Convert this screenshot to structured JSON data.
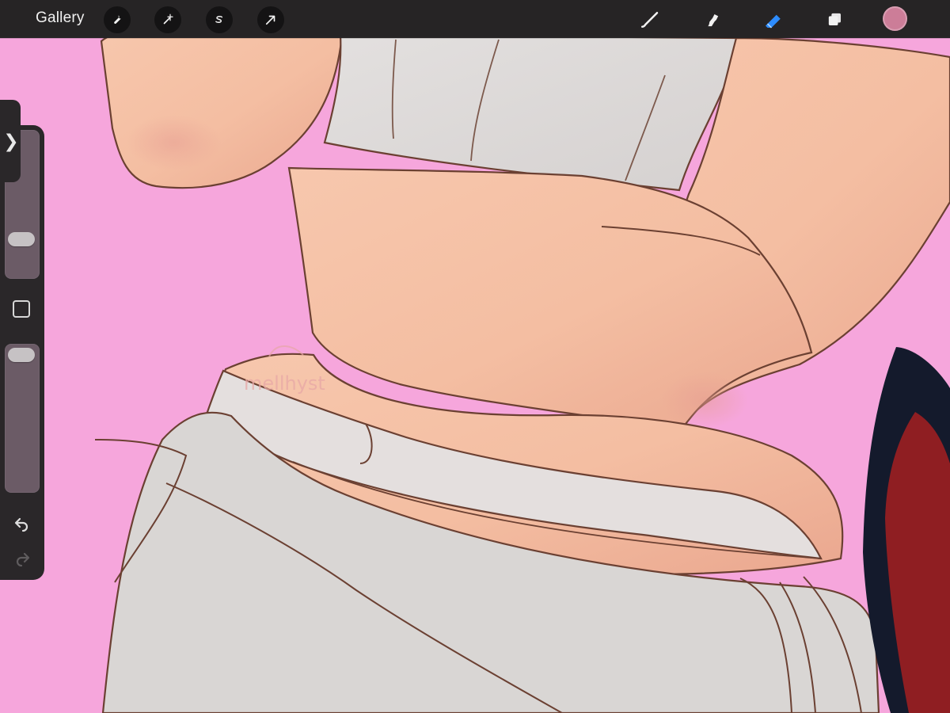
{
  "topbar": {
    "gallery_label": "Gallery",
    "tools_left": [
      {
        "name": "wrench-icon"
      },
      {
        "name": "magic-wand-icon"
      },
      {
        "name": "selection-icon"
      },
      {
        "name": "transform-arrow-icon"
      }
    ],
    "tools_right": [
      {
        "name": "brush-icon"
      },
      {
        "name": "smudge-icon"
      },
      {
        "name": "eraser-icon"
      },
      {
        "name": "layers-icon"
      }
    ],
    "current_color": "#cc7d98"
  },
  "sidebar": {
    "toggle_icon": "chevron-right-icon",
    "size_slider_level": 0.72,
    "opacity_slider_level": 0.08,
    "undo_icon": "undo-icon",
    "redo_icon": "redo-icon"
  },
  "canvas": {
    "signature_text": "mellhyst",
    "background_color": "#f6a6dc",
    "skin_color": "#f4c2a6",
    "clothing_color": "#dad7d6",
    "accent_red": "#8f1e22",
    "accent_navy": "#141a2c"
  }
}
